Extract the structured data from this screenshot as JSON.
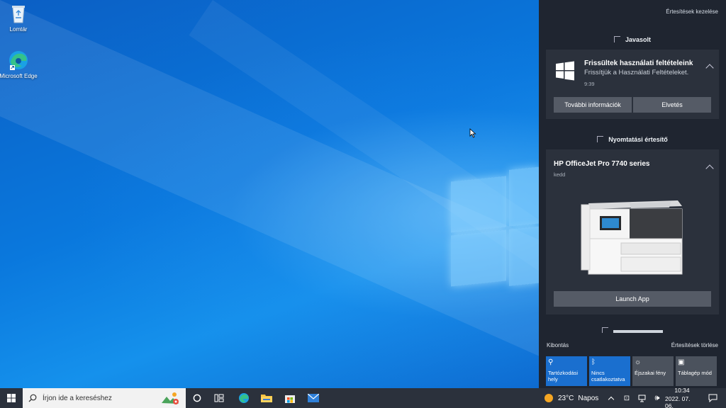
{
  "desktop": {
    "icons": [
      {
        "label": "Lomtár",
        "icon": "recycle-bin-icon"
      },
      {
        "label": "Microsoft Edge",
        "icon": "edge-icon"
      }
    ]
  },
  "action_center": {
    "manage_link": "Értesítések kezelése",
    "groups": [
      {
        "header": "Javasolt",
        "title": "Frissültek használati feltételeink",
        "body": "Frissítjük a Használati Feltételeket.",
        "time": "9:39",
        "buttons": [
          "További információk",
          "Elvetés"
        ]
      },
      {
        "header": "Nyomtatási értesítő",
        "title": "HP OfficeJet Pro 7740 series",
        "time": "kedd",
        "button": "Launch App"
      }
    ],
    "expand_label": "Kibontás",
    "clear_label": "Értesítések törlése",
    "quick_actions": [
      {
        "label": "Tartózkodási hely",
        "icon": "location-icon",
        "state": "on"
      },
      {
        "label": "Nincs csatlakoztatva",
        "icon": "bluetooth-icon",
        "state": "on"
      },
      {
        "label": "Éjszakai fény",
        "icon": "night-light-icon",
        "state": "off"
      },
      {
        "label": "Táblagép mód",
        "icon": "tablet-mode-icon",
        "state": "off"
      }
    ]
  },
  "taskbar": {
    "search_placeholder": "Írjon ide a kereséshez",
    "weather": {
      "temp": "23°C",
      "condition": "Napos"
    },
    "clock": {
      "time": "10:34",
      "date": "2022. 07. 06."
    },
    "colors": {
      "accent": "#1a6fcf",
      "taskbar": "#2b313c",
      "action_center": "#1f2530"
    }
  }
}
